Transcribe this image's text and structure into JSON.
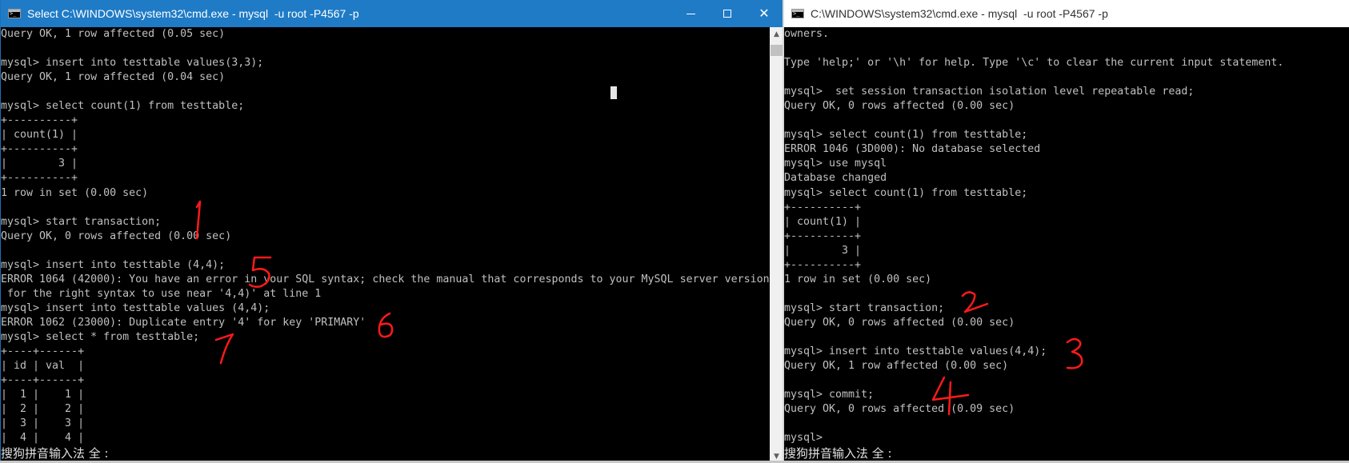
{
  "left_window": {
    "title": "Select C:\\WINDOWS\\system32\\cmd.exe - mysql  -u root -P4567 -p",
    "controls": {
      "minimize": "minimize",
      "maximize": "maximize",
      "close": "✕"
    },
    "lines": [
      "Query OK, 1 row affected (0.05 sec)",
      "",
      "mysql> insert into testtable values(3,3);",
      "Query OK, 1 row affected (0.04 sec)",
      "",
      "mysql> select count(1) from testtable;",
      "+----------+",
      "| count(1) |",
      "+----------+",
      "|        3 |",
      "+----------+",
      "1 row in set (0.00 sec)",
      "",
      "mysql> start transaction;",
      "Query OK, 0 rows affected (0.00 sec)",
      "",
      "mysql> insert into testtable (4,4);",
      "ERROR 1064 (42000): You have an error in your SQL syntax; check the manual that corresponds to your MySQL server version",
      " for the right syntax to use near '4,4)' at line 1",
      "mysql> insert into testtable values (4,4);",
      "ERROR 1062 (23000): Duplicate entry '4' for key 'PRIMARY'",
      "mysql> select * from testtable;",
      "+----+------+",
      "| id | val  |",
      "+----+------+",
      "|  1 |    1 |",
      "|  2 |    2 |",
      "|  3 |    3 |",
      "|  4 |    4 |"
    ],
    "ime": "搜狗拼音输入法 全 :"
  },
  "right_window": {
    "title": "C:\\WINDOWS\\system32\\cmd.exe - mysql  -u root -P4567 -p",
    "lines": [
      "owners.",
      "",
      "Type 'help;' or '\\h' for help. Type '\\c' to clear the current input statement.",
      "",
      "mysql>  set session transaction isolation level repeatable read;",
      "Query OK, 0 rows affected (0.00 sec)",
      "",
      "mysql> select count(1) from testtable;",
      "ERROR 1046 (3D000): No database selected",
      "mysql> use mysql",
      "Database changed",
      "mysql> select count(1) from testtable;",
      "+----------+",
      "| count(1) |",
      "+----------+",
      "|        3 |",
      "+----------+",
      "1 row in set (0.00 sec)",
      "",
      "mysql> start transaction;",
      "Query OK, 0 rows affected (0.00 sec)",
      "",
      "mysql> insert into testtable values(4,4);",
      "Query OK, 1 row affected (0.00 sec)",
      "",
      "mysql> commit;",
      "Query OK, 0 rows affected (0.09 sec)",
      "",
      "mysql>"
    ],
    "ime": "搜狗拼音输入法 全 :"
  },
  "annotations": {
    "color": "#ff1a1a",
    "labels": [
      "1",
      "2",
      "3",
      "4",
      "5",
      "6",
      "7"
    ]
  }
}
